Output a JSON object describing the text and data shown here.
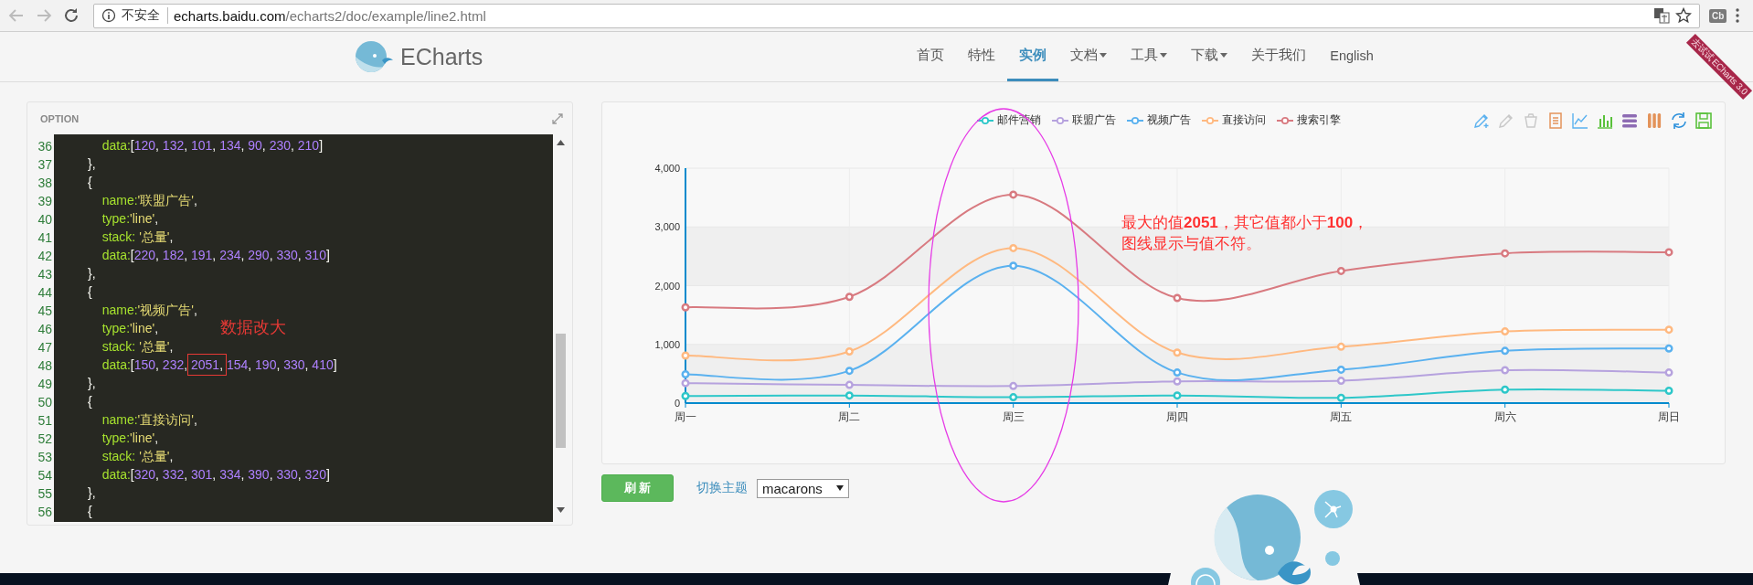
{
  "browser": {
    "security": "不安全",
    "url": {
      "host": "echarts.baidu.com",
      "path": "/echarts2/doc/example/line2.html"
    },
    "extension": "Cb"
  },
  "header": {
    "logo": "ECharts",
    "ribbon": "去试试 ECharts 3.0",
    "nav": [
      {
        "label": "首页",
        "selected": false,
        "caret": false
      },
      {
        "label": "特性",
        "selected": false,
        "caret": false
      },
      {
        "label": "实例",
        "selected": true,
        "caret": false
      },
      {
        "label": "文档",
        "selected": false,
        "caret": true
      },
      {
        "label": "工具",
        "selected": false,
        "caret": true
      },
      {
        "label": "下载",
        "selected": false,
        "caret": true
      },
      {
        "label": "关于我们",
        "selected": false,
        "caret": false
      },
      {
        "label": "English",
        "selected": false,
        "caret": false
      }
    ]
  },
  "editor": {
    "title": "OPTION",
    "note": "数据改大",
    "lines": [
      {
        "number": "36",
        "segments": [
          {
            "text": "            data:[120, 132, 101, 134, 90, 230, 210]",
            "boxed": false
          }
        ]
      },
      {
        "number": "37",
        "segments": [
          {
            "text": "        },",
            "boxed": false
          }
        ]
      },
      {
        "number": "38",
        "segments": [
          {
            "text": "        {",
            "boxed": false
          }
        ]
      },
      {
        "number": "39",
        "segments": [
          {
            "text": "            name:'联盟广告',",
            "boxed": false
          }
        ]
      },
      {
        "number": "40",
        "segments": [
          {
            "text": "            type:'line',",
            "boxed": false
          }
        ]
      },
      {
        "number": "41",
        "segments": [
          {
            "text": "            stack: '总量',",
            "boxed": false
          }
        ]
      },
      {
        "number": "42",
        "segments": [
          {
            "text": "            data:[220, 182, 191, 234, 290, 330, 310]",
            "boxed": false
          }
        ]
      },
      {
        "number": "43",
        "segments": [
          {
            "text": "        },",
            "boxed": false
          }
        ]
      },
      {
        "number": "44",
        "segments": [
          {
            "text": "        {",
            "boxed": false
          }
        ]
      },
      {
        "number": "45",
        "segments": [
          {
            "text": "            name:'视频广告',",
            "boxed": false
          }
        ]
      },
      {
        "number": "46",
        "segments": [
          {
            "text": "            type:'line',",
            "boxed": false
          }
        ]
      },
      {
        "number": "47",
        "segments": [
          {
            "text": "            stack: '总量',",
            "boxed": false
          }
        ]
      },
      {
        "number": "48",
        "segments": [
          {
            "text": "            data:[150, 232, ",
            "boxed": false
          },
          {
            "text": "2051,",
            "boxed": true
          },
          {
            "text": " 154, 190, 330, 410]",
            "boxed": false
          }
        ]
      },
      {
        "number": "49",
        "segments": [
          {
            "text": "        },",
            "boxed": false
          }
        ]
      },
      {
        "number": "50",
        "segments": [
          {
            "text": "        {",
            "boxed": false
          }
        ]
      },
      {
        "number": "51",
        "segments": [
          {
            "text": "            name:'直接访问',",
            "boxed": false
          }
        ]
      },
      {
        "number": "52",
        "segments": [
          {
            "text": "            type:'line',",
            "boxed": false
          }
        ]
      },
      {
        "number": "53",
        "segments": [
          {
            "text": "            stack: '总量',",
            "boxed": false
          }
        ]
      },
      {
        "number": "54",
        "segments": [
          {
            "text": "            data:[320, 332, 301, 334, 390, 330, 320]",
            "boxed": false
          }
        ]
      },
      {
        "number": "55",
        "segments": [
          {
            "text": "        },",
            "boxed": false
          }
        ]
      },
      {
        "number": "56",
        "segments": [
          {
            "text": "        {",
            "boxed": false
          }
        ]
      }
    ]
  },
  "chart_panel": {
    "toolbox": [
      {
        "kind": "mark",
        "disabled": false
      },
      {
        "kind": "mark-undo",
        "disabled": true
      },
      {
        "kind": "mark-clear",
        "disabled": true
      },
      {
        "kind": "data-view",
        "disabled": false
      },
      {
        "kind": "line",
        "disabled": false
      },
      {
        "kind": "bar",
        "disabled": false
      },
      {
        "kind": "stack",
        "disabled": false
      },
      {
        "kind": "tiled",
        "disabled": false
      },
      {
        "kind": "restore",
        "disabled": false
      },
      {
        "kind": "save",
        "disabled": false
      }
    ],
    "chart_data": {
      "type": "line",
      "grid": true,
      "categories": [
        "周一",
        "周二",
        "周三",
        "周四",
        "周五",
        "周六",
        "周日"
      ],
      "ylim": [
        0,
        4000
      ],
      "yticks": [
        {
          "value": 0,
          "label": "0"
        },
        {
          "value": 1000,
          "label": "1,000"
        },
        {
          "value": 2000,
          "label": "2,000"
        },
        {
          "value": 3000,
          "label": "3,000"
        },
        {
          "value": 4000,
          "label": "4,000"
        }
      ],
      "series": [
        {
          "name": "邮件营销",
          "color": "#2ec7c9",
          "marker": "circle",
          "values": [
            120,
            130,
            100,
            130,
            90,
            230,
            210
          ]
        },
        {
          "name": "联盟广告",
          "color": "#b6a2de",
          "marker": "circle",
          "values": [
            340,
            310,
            290,
            370,
            380,
            560,
            520
          ]
        },
        {
          "name": "视频广告",
          "color": "#5ab1ef",
          "marker": "circle",
          "values": [
            490,
            550,
            2340,
            520,
            570,
            890,
            930
          ]
        },
        {
          "name": "直接访问",
          "color": "#ffb980",
          "marker": "circle",
          "values": [
            810,
            880,
            2640,
            860,
            960,
            1220,
            1250
          ]
        },
        {
          "name": "搜索引擎",
          "color": "#d87a80",
          "marker": "circle",
          "values": [
            1630,
            1810,
            3550,
            1790,
            2250,
            2550,
            2570
          ]
        }
      ]
    },
    "note_lines": [
      "最大的值**2051**，其它值都小于**100**，",
      "图线显示与值不符。"
    ]
  },
  "controls": {
    "refresh": "刷 新",
    "theme_label": "切换主题",
    "theme_value": "macarons"
  }
}
